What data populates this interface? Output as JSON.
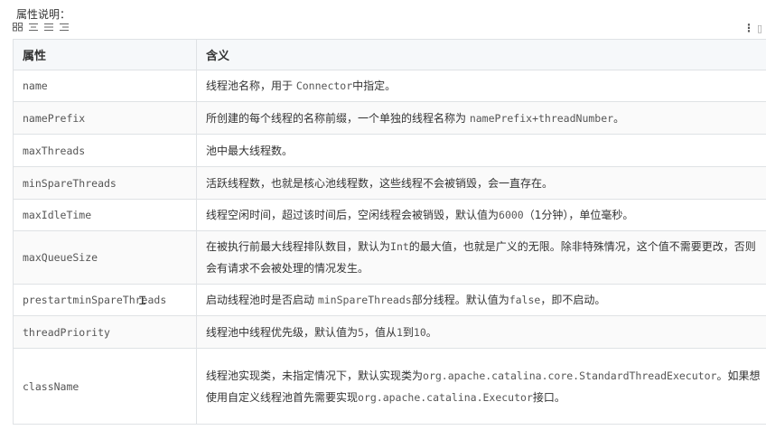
{
  "heading": "属性说明：",
  "toolbar": {
    "icons": [
      "grid-icon",
      "align-center-icon",
      "align-justify-icon",
      "align-right-icon"
    ],
    "more_icon": "more-vertical-icon"
  },
  "table": {
    "headers": [
      "属性",
      "含义"
    ],
    "rows": [
      {
        "attr": "name",
        "desc": [
          "线程池名称，用于 ",
          {
            "code": "Connector"
          },
          "中指定。"
        ]
      },
      {
        "attr": "namePrefix",
        "desc": [
          "所创建的每个线程的名称前缀，一个单独的线程名称为 ",
          {
            "code": "namePrefix+threadNumber"
          },
          "。"
        ]
      },
      {
        "attr": "maxThreads",
        "desc": [
          "池中最大线程数。"
        ]
      },
      {
        "attr": "minSpareThreads",
        "desc": [
          "活跃线程数，也就是核心池线程数，这些线程不会被销毁，会一直存在。"
        ]
      },
      {
        "attr": "maxIdleTime",
        "desc": [
          "线程空闲时间，超过该时间后，空闲线程会被销毁，默认值为",
          {
            "code": "6000"
          },
          "（1分钟），单位毫秒。"
        ]
      },
      {
        "attr": "maxQueueSize",
        "desc": [
          "在被执行前最大线程排队数目，默认为",
          {
            "code": "Int"
          },
          "的最大值，也就是广义的无限。除非特殊情况，这个值不需要更改，否则会有请求不会被处理的情况发生。"
        ]
      },
      {
        "attr": "prestartminSpareThreads",
        "desc": [
          "启动线程池时是否启动 ",
          {
            "code": "minSpareThreads"
          },
          "部分线程。默认值为",
          {
            "code": "false"
          },
          "，即不启动。"
        ]
      },
      {
        "attr": "threadPriority",
        "desc": [
          "线程池中线程优先级，默认值为",
          {
            "code": "5"
          },
          "，值从",
          {
            "code": "1"
          },
          "到",
          {
            "code": "10"
          },
          "。"
        ]
      },
      {
        "attr": "className",
        "desc": [
          "线程池实现类，未指定情况下，默认实现类为",
          {
            "code": "org.apache.catalina.core.StandardThreadExecutor"
          },
          "。如果想使用自定义线程池首先需要实现",
          {
            "code": "org.apache.catalina.Executor"
          },
          "接口。"
        ]
      }
    ]
  }
}
